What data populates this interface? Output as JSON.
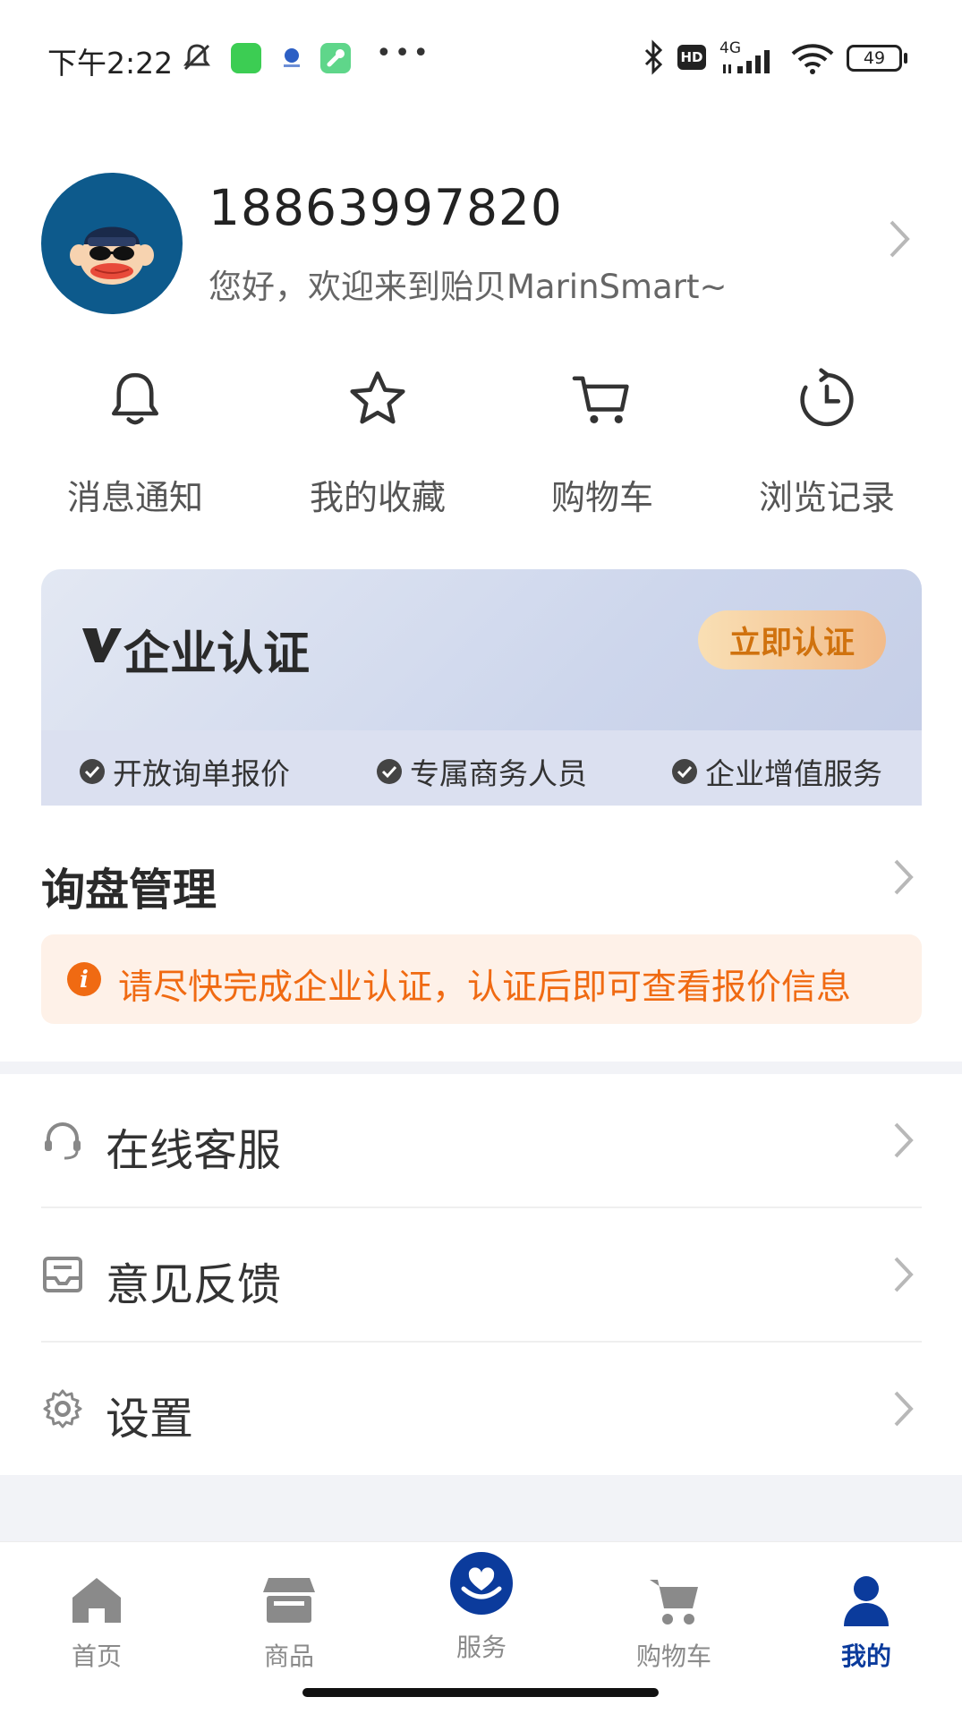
{
  "status_bar": {
    "time": "下午2:22",
    "network": "4G",
    "hd": "HD",
    "battery": "49"
  },
  "profile": {
    "phone": "18863997820",
    "welcome": "您好，欢迎来到贻贝MarinSmart~"
  },
  "quick_actions": [
    {
      "label": "消息通知",
      "icon": "bell-icon"
    },
    {
      "label": "我的收藏",
      "icon": "star-icon"
    },
    {
      "label": "购物车",
      "icon": "cart-icon"
    },
    {
      "label": "浏览记录",
      "icon": "clock-icon"
    }
  ],
  "certification": {
    "title": "企业认证",
    "button": "立即认证",
    "perks": [
      "开放询单报价",
      "专属商务人员",
      "企业增值服务"
    ]
  },
  "inquiry": {
    "title": "询盘管理",
    "notice": "请尽快完成企业认证，认证后即可查看报价信息"
  },
  "menu": [
    {
      "label": "在线客服",
      "icon": "headset-icon"
    },
    {
      "label": "意见反馈",
      "icon": "feedback-icon"
    },
    {
      "label": "设置",
      "icon": "gear-icon"
    }
  ],
  "tabbar": [
    {
      "label": "首页",
      "icon": "home-icon"
    },
    {
      "label": "商品",
      "icon": "store-icon"
    },
    {
      "label": "服务",
      "icon": "service-icon"
    },
    {
      "label": "购物车",
      "icon": "cart-icon"
    },
    {
      "label": "我的",
      "icon": "user-icon",
      "active": true
    }
  ],
  "colors": {
    "accent": "#0b3b9c",
    "notice_text": "#f06a12",
    "cert_button_text": "#d0720e"
  }
}
